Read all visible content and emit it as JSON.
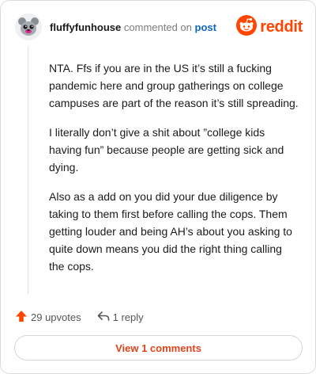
{
  "comment": {
    "username": "fluffyfunhouse",
    "commented_on": "commented on",
    "post_link": "post",
    "paragraphs": [
      "NTA. Ffs if you are in the US it’s still a fucking pandemic here and group gatherings on college campuses are part of the reason it’s still spreading.",
      "I literally don’t give a shit about ”college kids having fun” because people are getting sick and dying.",
      "Also as a add on you did your due diligence by taking to them first before calling the cops. Them getting louder and being AH’s about you asking to quite down means you did the right thing calling the cops."
    ]
  },
  "brand": {
    "name": "reddit",
    "color": "#ff4500"
  },
  "actions": {
    "upvotes": "29 upvotes",
    "reply": "1 reply"
  },
  "footer": {
    "view_comments": "View 1 comments",
    "accent": "#e0441a"
  },
  "icons": {
    "avatar": "snoo-avatar-icon",
    "logo": "reddit-logo-icon",
    "upvote": "upvote-arrow-icon",
    "reply": "reply-arrow-icon"
  }
}
